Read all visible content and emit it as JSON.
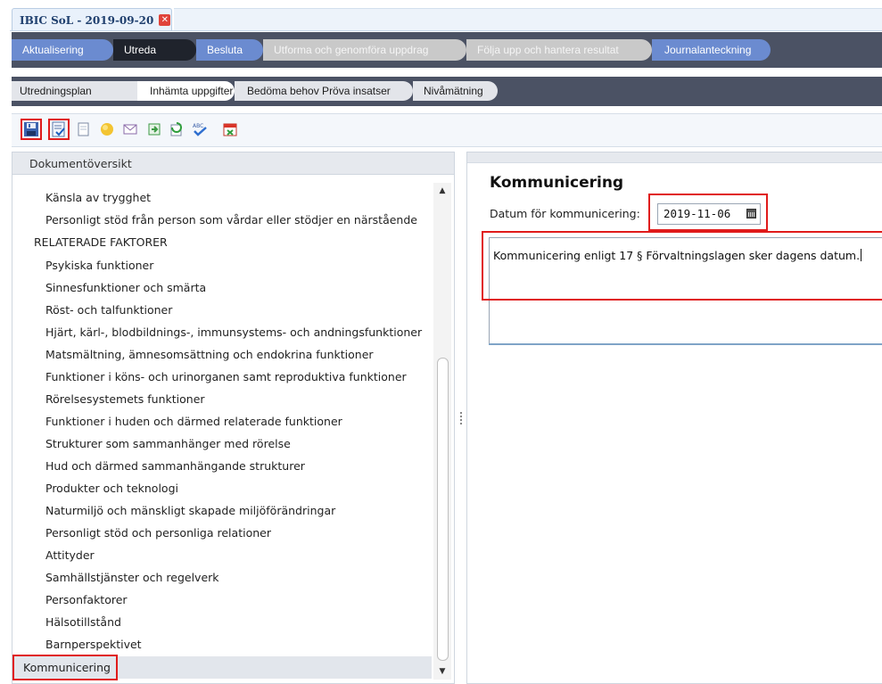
{
  "doc_tab": {
    "title": "IBIC SoL - 2019-09-20",
    "close_icon": "close-icon"
  },
  "phases": [
    {
      "label": "Aktualisering",
      "state": "active"
    },
    {
      "label": "Utreda",
      "state": "current"
    },
    {
      "label": "Besluta",
      "state": "active"
    },
    {
      "label": "Utforma och genomföra uppdrag",
      "state": "disabled"
    },
    {
      "label": "Följa upp och hantera resultat",
      "state": "disabled"
    },
    {
      "label": "Journalanteckning",
      "state": "active"
    }
  ],
  "steps": [
    {
      "label": "Utredningsplan",
      "state": "normal"
    },
    {
      "label": "Inhämta uppgifter",
      "state": "current"
    },
    {
      "label": "Bedöma behov Pröva insatser",
      "state": "normal"
    },
    {
      "label": "Nivåmätning",
      "state": "normal"
    }
  ],
  "toolbar": {
    "icons": [
      "save-icon",
      "save-and-close-icon",
      "new-document-icon",
      "note-icon",
      "mail-icon",
      "export-icon",
      "refresh-icon",
      "spellcheck-icon",
      "calendar-delete-icon"
    ]
  },
  "left_panel": {
    "header": "Dokumentöversikt",
    "items": [
      {
        "label": "Känsla av trygghet",
        "level": "child"
      },
      {
        "label": "Personligt stöd från person som vårdar eller stödjer en närstående",
        "level": "child"
      },
      {
        "label": "RELATERADE FAKTORER",
        "level": "category"
      },
      {
        "label": "Psykiska funktioner",
        "level": "child"
      },
      {
        "label": "Sinnesfunktioner och smärta",
        "level": "child"
      },
      {
        "label": "Röst- och talfunktioner",
        "level": "child"
      },
      {
        "label": "Hjärt, kärl-, blodbildnings-, immunsystems- och andningsfunktioner",
        "level": "child"
      },
      {
        "label": "Matsmältning, ämnesomsättning och endokrina funktioner",
        "level": "child"
      },
      {
        "label": "Funktioner i köns- och urinorganen samt reproduktiva funktioner",
        "level": "child"
      },
      {
        "label": "Rörelsesystemets funktioner",
        "level": "child"
      },
      {
        "label": "Funktioner i huden och därmed relaterade funktioner",
        "level": "child"
      },
      {
        "label": "Strukturer som sammanhänger med rörelse",
        "level": "child"
      },
      {
        "label": "Hud och därmed sammanhängande strukturer",
        "level": "child"
      },
      {
        "label": "Produkter och teknologi",
        "level": "child"
      },
      {
        "label": "Naturmiljö och mänskligt skapade miljöförändringar",
        "level": "child"
      },
      {
        "label": "Personligt stöd och personliga relationer",
        "level": "child"
      },
      {
        "label": "Attityder",
        "level": "child"
      },
      {
        "label": "Samhällstjänster och regelverk",
        "level": "child"
      },
      {
        "label": "Personfaktorer",
        "level": "child"
      },
      {
        "label": "Hälsotillstånd",
        "level": "child"
      },
      {
        "label": "Barnperspektivet",
        "level": "child"
      },
      {
        "label": "Kommunicering",
        "level": "selected"
      }
    ]
  },
  "right_panel": {
    "title": "Kommunicering",
    "date_label": "Datum för kommunicering:",
    "date_value": "2019-11-06",
    "note_text": "Kommunicering enligt 17 § Förvaltningslagen sker dagens datum."
  },
  "colors": {
    "highlight": "#e01b1b",
    "phase_bar": "#4b5264",
    "phase_active": "#6b8bd0",
    "phase_current": "#1f232c",
    "phase_disabled": "#c9c9c9"
  }
}
